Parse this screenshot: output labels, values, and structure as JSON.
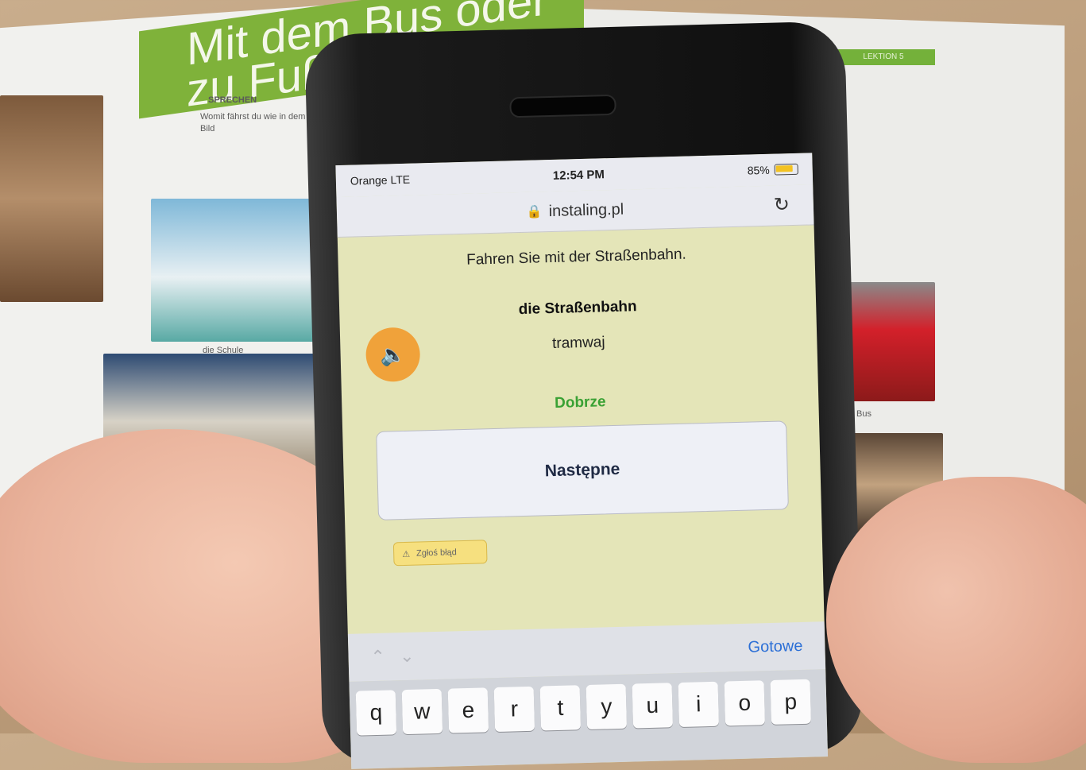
{
  "book": {
    "banner_text": "Mit dem Bus oder zu Fuß",
    "section_heading": "SPRECHEN",
    "body_text": "Womit fährst du wie in dem Bild",
    "caption_school": "die Schule",
    "caption_bus": "Bus",
    "right_tag": "LEKTION 5"
  },
  "status_bar": {
    "carrier": "Orange LTE",
    "time": "12:54 PM",
    "battery": "85%"
  },
  "browser": {
    "url": "instaling.pl",
    "reload_icon": "↻",
    "lock_icon": "🔒"
  },
  "lesson": {
    "sentence": "Fahren Sie mit der Straßenbahn.",
    "word_de": "die Straßenbahn",
    "word_pl": "tramwaj",
    "result": "Dobrze",
    "next_label": "Następne",
    "report_label": "Zgłoś błąd",
    "audio_icon": "speaker-icon"
  },
  "keyboard": {
    "done_label": "Gotowe",
    "keys": [
      "q",
      "w",
      "e",
      "r",
      "t",
      "y",
      "u",
      "i",
      "o",
      "p"
    ]
  },
  "colors": {
    "app_background": "#e4e5b8",
    "result_green": "#3aa134",
    "audio_orange": "#f0a23a",
    "done_blue": "#2c6fd6"
  }
}
